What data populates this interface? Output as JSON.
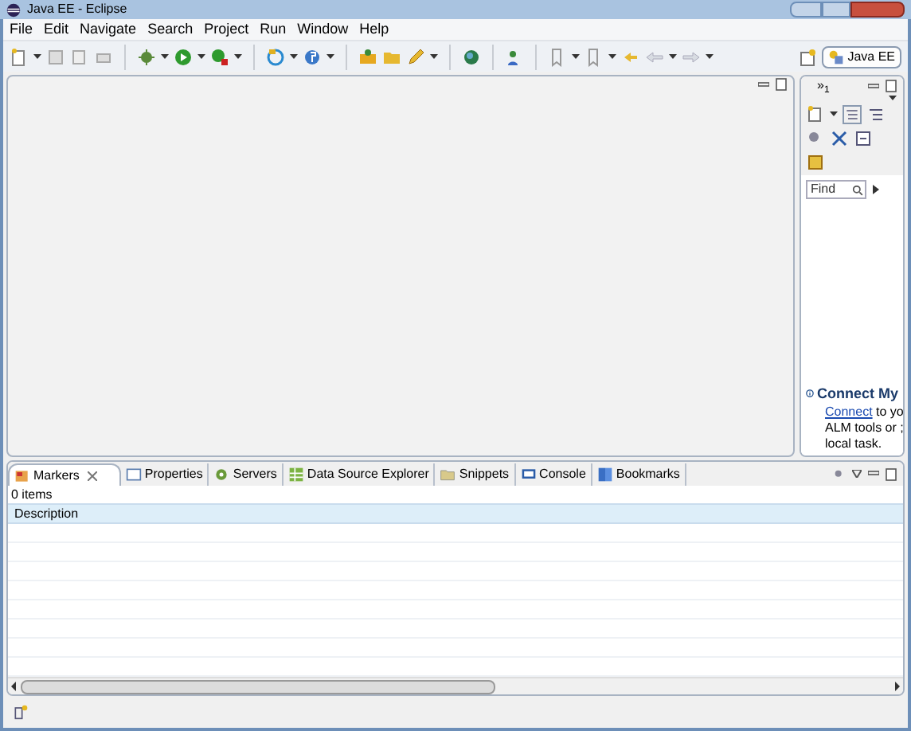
{
  "window": {
    "title": "Java EE - Eclipse"
  },
  "menu": [
    "File",
    "Edit",
    "Navigate",
    "Search",
    "Project",
    "Run",
    "Window",
    "Help"
  ],
  "perspective": {
    "label": "Java EE",
    "selected": true
  },
  "side_panel": {
    "tab": "»",
    "tab_count": "1",
    "find_placeholder": "Find",
    "connect_title": "Connect My",
    "connect_link": "Connect",
    "connect_lines": [
      "to yo",
      "ALM tools or ;",
      "local task."
    ]
  },
  "bottom_tabs": [
    {
      "label": "Markers",
      "selected": true
    },
    {
      "label": "Properties",
      "selected": false
    },
    {
      "label": "Servers",
      "selected": false
    },
    {
      "label": "Data Source Explorer",
      "selected": false
    },
    {
      "label": "Snippets",
      "selected": false
    },
    {
      "label": "Console",
      "selected": false
    },
    {
      "label": "Bookmarks",
      "selected": false
    }
  ],
  "markers": {
    "count": "0 items",
    "columns": [
      "Description"
    ]
  }
}
